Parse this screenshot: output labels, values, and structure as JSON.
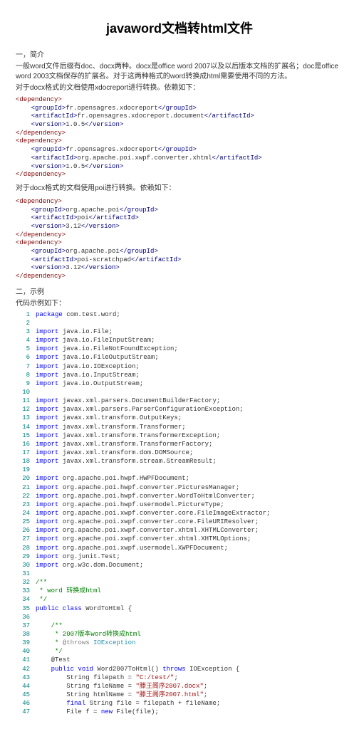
{
  "title": "javaword文档转html文件",
  "intro_heading": "一，简介",
  "intro_p1": "一般word文件后缀有doc、docx两种。docx是office word 2007以及以后版本文档的扩展名；doc是office word 2003文档保存的扩展名。对于这两种格式的word转换成html需要使用不同的方法。",
  "intro_p2": "对于docx格式的文档使用xdocreport进行转换。依赖如下：",
  "deps1": [
    {
      "indent": 0,
      "t": "<dependency>"
    },
    {
      "indent": 1,
      "open": "<groupId>",
      "val": "fr.opensagres.xdocreport",
      "close": "</groupId>"
    },
    {
      "indent": 1,
      "open": "<artifactId>",
      "val": "fr.opensagres.xdocreport.document",
      "close": "</artifactId>"
    },
    {
      "indent": 1,
      "open": "<version>",
      "val": "1.0.5",
      "close": "</version>"
    },
    {
      "indent": 0,
      "t": "</dependency>"
    },
    {
      "indent": 0,
      "t": "<dependency>"
    },
    {
      "indent": 1,
      "open": "<groupId>",
      "val": "fr.opensagres.xdocreport",
      "close": "</groupId>"
    },
    {
      "indent": 1,
      "open": "<artifactId>",
      "val": "org.apache.poi.xwpf.converter.xhtml",
      "close": "</artifactId>"
    },
    {
      "indent": 1,
      "open": "<version>",
      "val": "1.0.5",
      "close": "</version>"
    },
    {
      "indent": 0,
      "t": "</dependency>"
    }
  ],
  "mid_p": "对于docx格式的文档使用poi进行转换。依赖如下：",
  "deps2": [
    {
      "indent": 0,
      "t": "<dependency>"
    },
    {
      "indent": 1,
      "open": "<groupId>",
      "val": "org.apache.poi",
      "close": "</groupId>"
    },
    {
      "indent": 1,
      "open": "<artifactId>",
      "val": "poi",
      "close": "</artifactId>"
    },
    {
      "indent": 1,
      "open": "<version>",
      "val": "3.12",
      "close": "</version>"
    },
    {
      "indent": 0,
      "t": "</dependency>"
    },
    {
      "indent": 0,
      "t": "<dependency>"
    },
    {
      "indent": 1,
      "open": "<groupId>",
      "val": "org.apache.poi",
      "close": "</groupId>"
    },
    {
      "indent": 1,
      "open": "<artifactId>",
      "val": "poi-scratchpad",
      "close": "</artifactId>"
    },
    {
      "indent": 1,
      "open": "<version>",
      "val": "3.12",
      "close": "</version>"
    },
    {
      "indent": 0,
      "t": "</dependency>"
    }
  ],
  "example_heading": "二，示例",
  "example_sub": "        代码示例如下：",
  "code": [
    {
      "n": 1,
      "seg": [
        {
          "c": "kw",
          "t": "package"
        },
        {
          "t": " com.test.word;"
        }
      ]
    },
    {
      "n": 2,
      "seg": []
    },
    {
      "n": 3,
      "seg": [
        {
          "c": "kw",
          "t": "import"
        },
        {
          "t": " java.io.File;"
        }
      ]
    },
    {
      "n": 4,
      "seg": [
        {
          "c": "kw",
          "t": "import"
        },
        {
          "t": " java.io.FileInputStream;"
        }
      ]
    },
    {
      "n": 5,
      "seg": [
        {
          "c": "kw",
          "t": "import"
        },
        {
          "t": " java.io.FileNotFoundException;"
        }
      ]
    },
    {
      "n": 6,
      "seg": [
        {
          "c": "kw",
          "t": "import"
        },
        {
          "t": " java.io.FileOutputStream;"
        }
      ]
    },
    {
      "n": 7,
      "seg": [
        {
          "c": "kw",
          "t": "import"
        },
        {
          "t": " java.io.IOException;"
        }
      ]
    },
    {
      "n": 8,
      "seg": [
        {
          "c": "kw",
          "t": "import"
        },
        {
          "t": " java.io.InputStream;"
        }
      ]
    },
    {
      "n": 9,
      "seg": [
        {
          "c": "kw",
          "t": "import"
        },
        {
          "t": " java.io.OutputStream;"
        }
      ]
    },
    {
      "n": 10,
      "seg": []
    },
    {
      "n": 11,
      "seg": [
        {
          "c": "kw",
          "t": "import"
        },
        {
          "t": " javax.xml.parsers.DocumentBuilderFactory;"
        }
      ]
    },
    {
      "n": 12,
      "seg": [
        {
          "c": "kw",
          "t": "import"
        },
        {
          "t": " javax.xml.parsers.ParserConfigurationException;"
        }
      ]
    },
    {
      "n": 13,
      "seg": [
        {
          "c": "kw",
          "t": "import"
        },
        {
          "t": " javax.xml.transform.OutputKeys;"
        }
      ]
    },
    {
      "n": 14,
      "seg": [
        {
          "c": "kw",
          "t": "import"
        },
        {
          "t": " javax.xml.transform.Transformer;"
        }
      ]
    },
    {
      "n": 15,
      "seg": [
        {
          "c": "kw",
          "t": "import"
        },
        {
          "t": " javax.xml.transform.TransformerException;"
        }
      ]
    },
    {
      "n": 16,
      "seg": [
        {
          "c": "kw",
          "t": "import"
        },
        {
          "t": " javax.xml.transform.TransformerFactory;"
        }
      ]
    },
    {
      "n": 17,
      "seg": [
        {
          "c": "kw",
          "t": "import"
        },
        {
          "t": " javax.xml.transform.dom.DOMSource;"
        }
      ]
    },
    {
      "n": 18,
      "seg": [
        {
          "c": "kw",
          "t": "import"
        },
        {
          "t": " javax.xml.transform.stream.StreamResult;"
        }
      ]
    },
    {
      "n": 19,
      "seg": []
    },
    {
      "n": 20,
      "seg": [
        {
          "c": "kw",
          "t": "import"
        },
        {
          "t": " org.apache.poi.hwpf.HWPFDocument;"
        }
      ]
    },
    {
      "n": 21,
      "seg": [
        {
          "c": "kw",
          "t": "import"
        },
        {
          "t": " org.apache.poi.hwpf.converter.PicturesManager;"
        }
      ]
    },
    {
      "n": 22,
      "seg": [
        {
          "c": "kw",
          "t": "import"
        },
        {
          "t": " org.apache.poi.hwpf.converter.WordToHtmlConverter;"
        }
      ]
    },
    {
      "n": 23,
      "seg": [
        {
          "c": "kw",
          "t": "import"
        },
        {
          "t": " org.apache.poi.hwpf.usermodel.PictureType;"
        }
      ]
    },
    {
      "n": 24,
      "seg": [
        {
          "c": "kw",
          "t": "import"
        },
        {
          "t": " org.apache.poi.xwpf.converter.core.FileImageExtractor;"
        }
      ]
    },
    {
      "n": 25,
      "seg": [
        {
          "c": "kw",
          "t": "import"
        },
        {
          "t": " org.apache.poi.xwpf.converter.core.FileURIResolver;"
        }
      ]
    },
    {
      "n": 26,
      "seg": [
        {
          "c": "kw",
          "t": "import"
        },
        {
          "t": " org.apache.poi.xwpf.converter.xhtml.XHTMLConverter;"
        }
      ]
    },
    {
      "n": 27,
      "seg": [
        {
          "c": "kw",
          "t": "import"
        },
        {
          "t": " org.apache.poi.xwpf.converter.xhtml.XHTMLOptions;"
        }
      ]
    },
    {
      "n": 28,
      "seg": [
        {
          "c": "kw",
          "t": "import"
        },
        {
          "t": " org.apache.poi.xwpf.usermodel.XWPFDocument;"
        }
      ]
    },
    {
      "n": 29,
      "seg": [
        {
          "c": "kw",
          "t": "import"
        },
        {
          "t": " org.junit.Test;"
        }
      ]
    },
    {
      "n": 30,
      "seg": [
        {
          "c": "kw",
          "t": "import"
        },
        {
          "t": " org.w3c.dom.Document;"
        }
      ]
    },
    {
      "n": 31,
      "seg": []
    },
    {
      "n": 32,
      "seg": [
        {
          "c": "com",
          "t": "/**"
        }
      ]
    },
    {
      "n": 33,
      "seg": [
        {
          "c": "com",
          "t": " * word 转换成html"
        }
      ]
    },
    {
      "n": 34,
      "seg": [
        {
          "c": "com",
          "t": " */"
        }
      ]
    },
    {
      "n": 35,
      "seg": [
        {
          "c": "kw",
          "t": "public class"
        },
        {
          "t": " WordToHtml {"
        }
      ]
    },
    {
      "n": 36,
      "seg": []
    },
    {
      "n": 37,
      "seg": [
        {
          "t": "    "
        },
        {
          "c": "com",
          "t": "/**"
        }
      ]
    },
    {
      "n": 38,
      "seg": [
        {
          "t": "    "
        },
        {
          "c": "com",
          "t": " * 2007版本word转换成html"
        }
      ]
    },
    {
      "n": 39,
      "seg": [
        {
          "t": "    "
        },
        {
          "c": "com",
          "t": " * "
        },
        {
          "c": "ann",
          "t": "@throws"
        },
        {
          "c": "com",
          "t": " "
        },
        {
          "c": "type",
          "t": "IOException"
        }
      ]
    },
    {
      "n": 40,
      "seg": [
        {
          "t": "    "
        },
        {
          "c": "com",
          "t": " */"
        }
      ]
    },
    {
      "n": 41,
      "seg": [
        {
          "t": "    @Test"
        }
      ]
    },
    {
      "n": 42,
      "seg": [
        {
          "t": "    "
        },
        {
          "c": "kw",
          "t": "public void"
        },
        {
          "t": " Word2007ToHtml() "
        },
        {
          "c": "kw",
          "t": "throws"
        },
        {
          "t": " IOException {"
        }
      ]
    },
    {
      "n": 43,
      "seg": [
        {
          "t": "        String filepath = "
        },
        {
          "c": "str",
          "t": "\"C:/test/\""
        },
        {
          "t": ";"
        }
      ]
    },
    {
      "n": 44,
      "seg": [
        {
          "t": "        String fileName = "
        },
        {
          "c": "str",
          "t": "\"滕王阁序2007.docx\""
        },
        {
          "t": ";"
        }
      ]
    },
    {
      "n": 45,
      "seg": [
        {
          "t": "        String htmlName = "
        },
        {
          "c": "str",
          "t": "\"滕王阁序2007.html\""
        },
        {
          "t": ";"
        }
      ]
    },
    {
      "n": 46,
      "seg": [
        {
          "t": "        "
        },
        {
          "c": "kw",
          "t": "final"
        },
        {
          "t": " String file = filepath + fileName;"
        }
      ]
    },
    {
      "n": 47,
      "seg": [
        {
          "t": "        File f = "
        },
        {
          "c": "kw",
          "t": "new"
        },
        {
          "t": " File(file);"
        }
      ]
    }
  ]
}
